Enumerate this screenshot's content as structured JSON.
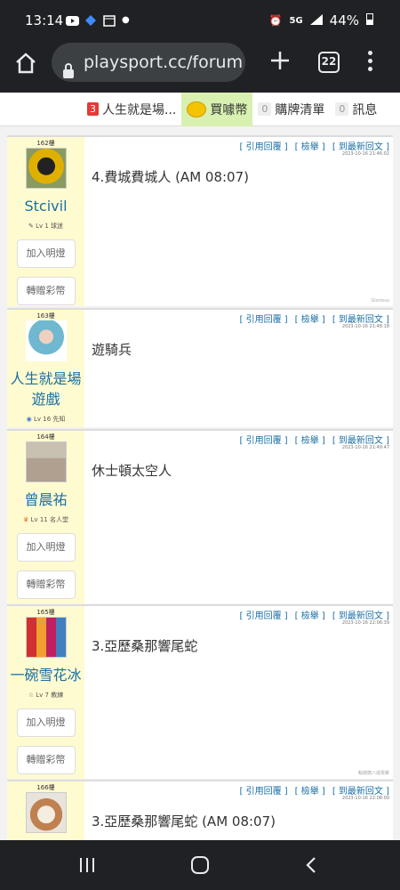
{
  "status": {
    "time": "13:14",
    "battery": "44%",
    "network": "5G"
  },
  "browser": {
    "url": "playsport.cc/forum",
    "tab_count": "22"
  },
  "topnav": [
    {
      "count": "3",
      "label": "人生就是場..."
    },
    {
      "label": "買噱幣"
    },
    {
      "count": "0",
      "label": "購牌清單"
    },
    {
      "count": "0",
      "label": "訊息"
    }
  ],
  "actions": {
    "quote": "[ 引用回覆 ]",
    "report": "[ 檢舉 ]",
    "latest": "[ 到最新回文 ]"
  },
  "buttons": {
    "follow": "加入明燈",
    "gift": "轉贈彩幣"
  },
  "posts": [
    {
      "floor": "162樓",
      "username": "Stcivil",
      "level": "Lv 1 球迷",
      "time": "2023-10-16 21:46:02",
      "text": "4.費城費城人 (AM 08:07)",
      "signature": "Glorious"
    },
    {
      "floor": "163樓",
      "username": "人生就是場遊戲",
      "level": "Lv 16 先知",
      "time": "2023-10-16 21:48:18",
      "text": "遊騎兵",
      "signature": ""
    },
    {
      "floor": "164樓",
      "username": "曾晨祐",
      "level": "Lv 11 名人堂",
      "time": "2023-10-16 21:49:47",
      "text": "休士頓太空人",
      "signature": ""
    },
    {
      "floor": "165樓",
      "username": "一碗雪花冰",
      "level": "Lv 7 教練",
      "time": "2023-10-16 22:06:39",
      "text": "3.亞歷桑那響尾蛇",
      "signature": "輸錢廣八戒靠聚"
    },
    {
      "floor": "166樓",
      "username": "",
      "level": "",
      "time": "2023-10-16 22:08:00",
      "text": "3.亞歷桑那響尾蛇 (AM 08:07)",
      "signature": ""
    }
  ]
}
